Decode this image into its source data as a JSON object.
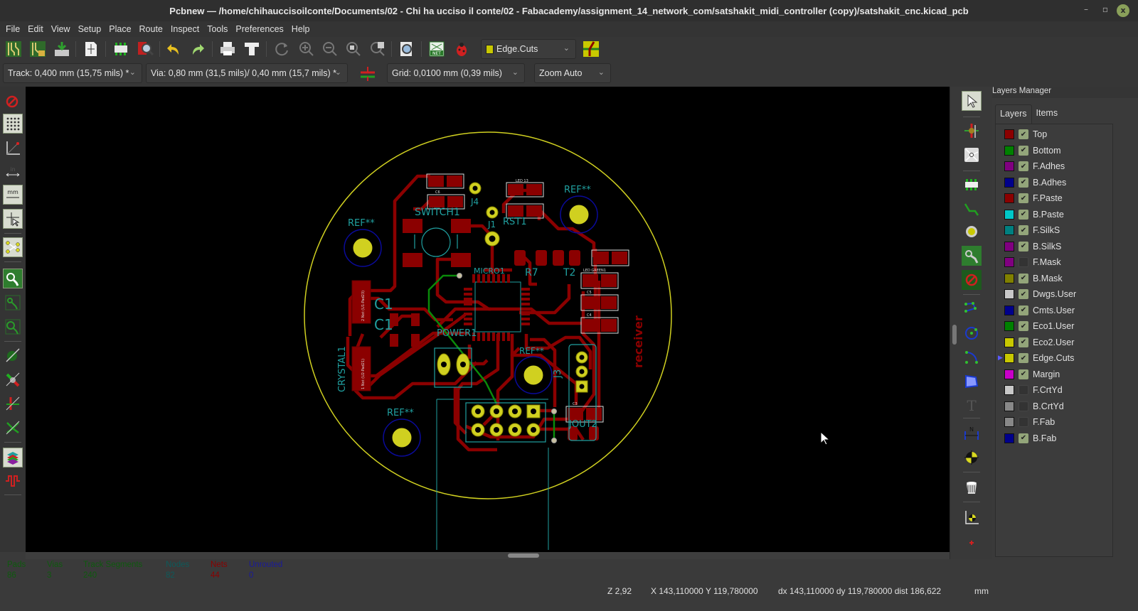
{
  "window": {
    "title": "Pcbnew — /home/chihauccisoilconte/Documents/02 - Chi ha ucciso il conte/02 - Fabacademy/assignment_14_network_com/satshakit_midi_controller (copy)/satshakit_cnc.kicad_pcb",
    "minimize": "–",
    "maximize": "▫",
    "close": "x"
  },
  "menu": [
    "File",
    "Edit",
    "View",
    "Setup",
    "Place",
    "Route",
    "Inspect",
    "Tools",
    "Preferences",
    "Help"
  ],
  "toolbar": {
    "active_layer": "Edge.Cuts",
    "active_layer_color": "#c8c800",
    "track": "Track: 0,400 mm (15,75 mils) *",
    "via": "Via: 0,80 mm (31,5 mils)/ 0,40 mm (15,7 mils) *",
    "grid": "Grid: 0,0100 mm (0,39 mils)",
    "zoom": "Zoom Auto"
  },
  "layers_manager": {
    "title": "Layers Manager",
    "tabs": [
      "Layers",
      "Items"
    ],
    "active_tab": "Layers",
    "layers": [
      {
        "name": "Top",
        "color": "#8b0000",
        "visible": true
      },
      {
        "name": "Bottom",
        "color": "#008000",
        "visible": true
      },
      {
        "name": "F.Adhes",
        "color": "#800080",
        "visible": true
      },
      {
        "name": "B.Adhes",
        "color": "#00008b",
        "visible": true
      },
      {
        "name": "F.Paste",
        "color": "#8b0000",
        "visible": true
      },
      {
        "name": "B.Paste",
        "color": "#00c8c8",
        "visible": true
      },
      {
        "name": "F.SilkS",
        "color": "#008080",
        "visible": true
      },
      {
        "name": "B.SilkS",
        "color": "#800080",
        "visible": true
      },
      {
        "name": "F.Mask",
        "color": "#800080",
        "visible": false
      },
      {
        "name": "B.Mask",
        "color": "#808000",
        "visible": true
      },
      {
        "name": "Dwgs.User",
        "color": "#c8c8c8",
        "visible": true
      },
      {
        "name": "Cmts.User",
        "color": "#00008b",
        "visible": true
      },
      {
        "name": "Eco1.User",
        "color": "#008000",
        "visible": true
      },
      {
        "name": "Eco2.User",
        "color": "#c8c800",
        "visible": true
      },
      {
        "name": "Edge.Cuts",
        "color": "#c8c800",
        "visible": true,
        "selected": true
      },
      {
        "name": "Margin",
        "color": "#c800c8",
        "visible": true
      },
      {
        "name": "F.CrtYd",
        "color": "#c8c8c8",
        "visible": false
      },
      {
        "name": "B.CrtYd",
        "color": "#888888",
        "visible": false
      },
      {
        "name": "F.Fab",
        "color": "#888888",
        "visible": false
      },
      {
        "name": "B.Fab",
        "color": "#00008b",
        "visible": true
      }
    ]
  },
  "board_stats": [
    {
      "label": "Pads",
      "value": "86",
      "color": "#0e5a0e"
    },
    {
      "label": "Vias",
      "value": "3",
      "color": "#0e5a0e"
    },
    {
      "label": "Track Segments",
      "value": "240",
      "color": "#0e5a0e"
    },
    {
      "label": "Nodes",
      "value": "82",
      "color": "#0e5a5a"
    },
    {
      "label": "Nets",
      "value": "44",
      "color": "#8b0000"
    },
    {
      "label": "Unrouted",
      "value": "0",
      "color": "#1a1a9a"
    }
  ],
  "status": {
    "zoom": "Z 2,92",
    "xy": "X 143,110000  Y 119,780000",
    "delta": "dx 143,110000  dy 119,780000  dist 186,622",
    "units": "mm"
  },
  "pcb": {
    "labels": {
      "ref1": "REF**",
      "ref2": "REF**",
      "ref3": "REF**",
      "ref4": "REF**",
      "switch": "SWITCH1",
      "j1": "J1",
      "j4": "J4",
      "rst": "RST1",
      "micro": "MICRO1",
      "r7": "R7",
      "t2": "T2",
      "c1": "C1",
      "c2": "C1",
      "crystal": "CRYSTAL1",
      "power": "POWER1",
      "j3": "J3",
      "receiver": "receiver",
      "led_green": "LED GREEN1",
      "c5": "C5",
      "c4": "C4",
      "led13": "LED 13",
      "c6": "C6",
      "c3": "C3",
      "isp": "JOUT2",
      "xtal_pad2": "2  Not (U1-Pad23)",
      "xtal_pad1": "1  Not (U2-Pad21)"
    }
  }
}
